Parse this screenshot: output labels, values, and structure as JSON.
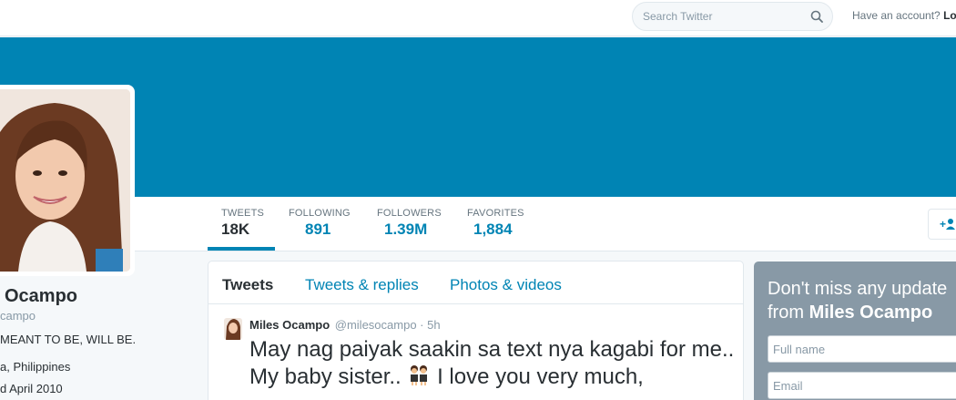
{
  "topbar": {
    "search_placeholder": "Search Twitter",
    "account_prompt": "Have an account?",
    "login_label": "Lo"
  },
  "banner": {
    "color": "#0084b4"
  },
  "stats": [
    {
      "label": "TWEETS",
      "value": "18K"
    },
    {
      "label": "FOLLOWING",
      "value": "891"
    },
    {
      "label": "FOLLOWERS",
      "value": "1.39M"
    },
    {
      "label": "FAVORITES",
      "value": "1,884"
    }
  ],
  "profile": {
    "name": "Ocampo",
    "handle": "campo",
    "bio": "MEANT TO BE, WILL BE.",
    "location": "a, Philippines",
    "joined": "d April 2010"
  },
  "timeline": {
    "tabs": [
      "Tweets",
      "Tweets & replies",
      "Photos & videos"
    ],
    "tweet": {
      "name": "Miles Ocampo",
      "handle": "@milesocampo",
      "separator": "·",
      "time": "5h",
      "text_part1": "May nag paiyak saakin sa text nya kagabi for me.. My baby sister..",
      "text_part2": "I love you very much,"
    }
  },
  "signup": {
    "title_line1": "Don't miss any update",
    "title_prefix": "from",
    "title_name": "Miles Ocampo",
    "fullname_placeholder": "Full name",
    "email_placeholder": "Email"
  },
  "icons": {
    "search": "search-icon",
    "follow": "add-user-icon",
    "emoji": "twins-emoji-icon"
  },
  "colors": {
    "accent": "#0084b4",
    "signup_bg": "#8899a6"
  }
}
